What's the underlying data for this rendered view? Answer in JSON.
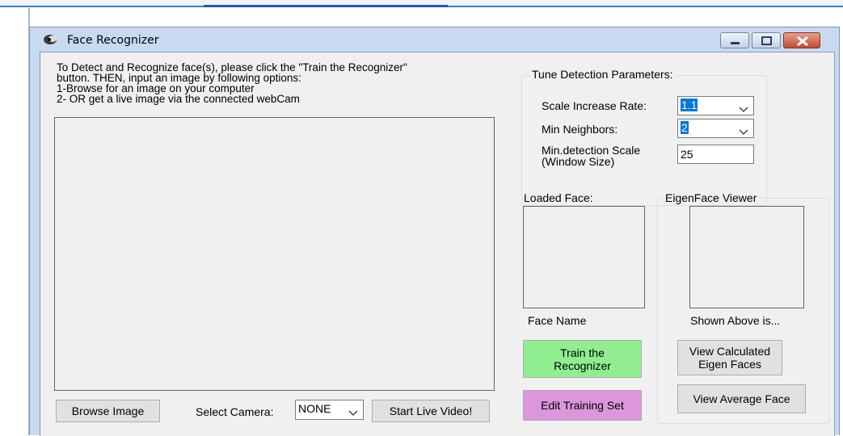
{
  "window": {
    "title": "Face Recognizer"
  },
  "instructions": {
    "line1": "To Detect and Recognize face(s), please click the \"Train the Recognizer\"",
    "line2": "button. THEN, input an image by following options:",
    "line3": "1-Browse for an image on your computer",
    "line4": "2- OR get a live image via the connected webCam"
  },
  "bottom_bar": {
    "browse_label": "Browse Image",
    "camera_label": "Select Camera:",
    "camera_value": "NONE",
    "start_label": "Start Live Video!"
  },
  "tune": {
    "legend": "Tune Detection Parameters:",
    "scale_label": "Scale Increase Rate:",
    "scale_value": "1.1",
    "neighbors_label": "Min Neighbors:",
    "neighbors_value": "2",
    "minscale_label_line1": "Min.detection Scale",
    "minscale_label_line2": "(Window Size)",
    "minscale_value": "25"
  },
  "loaded_face": {
    "label": "Loaded Face:",
    "name_label": "Face Name"
  },
  "eigen": {
    "legend": "EigenFace Viewer",
    "caption": "Shown Above is...",
    "view_calc_line1": "View Calculated",
    "view_calc_line2": "Eigen Faces",
    "view_avg": "View Average Face"
  },
  "actions": {
    "train_line1": "Train the",
    "train_line2": "Recognizer",
    "edit_training": "Edit Training Set"
  }
}
